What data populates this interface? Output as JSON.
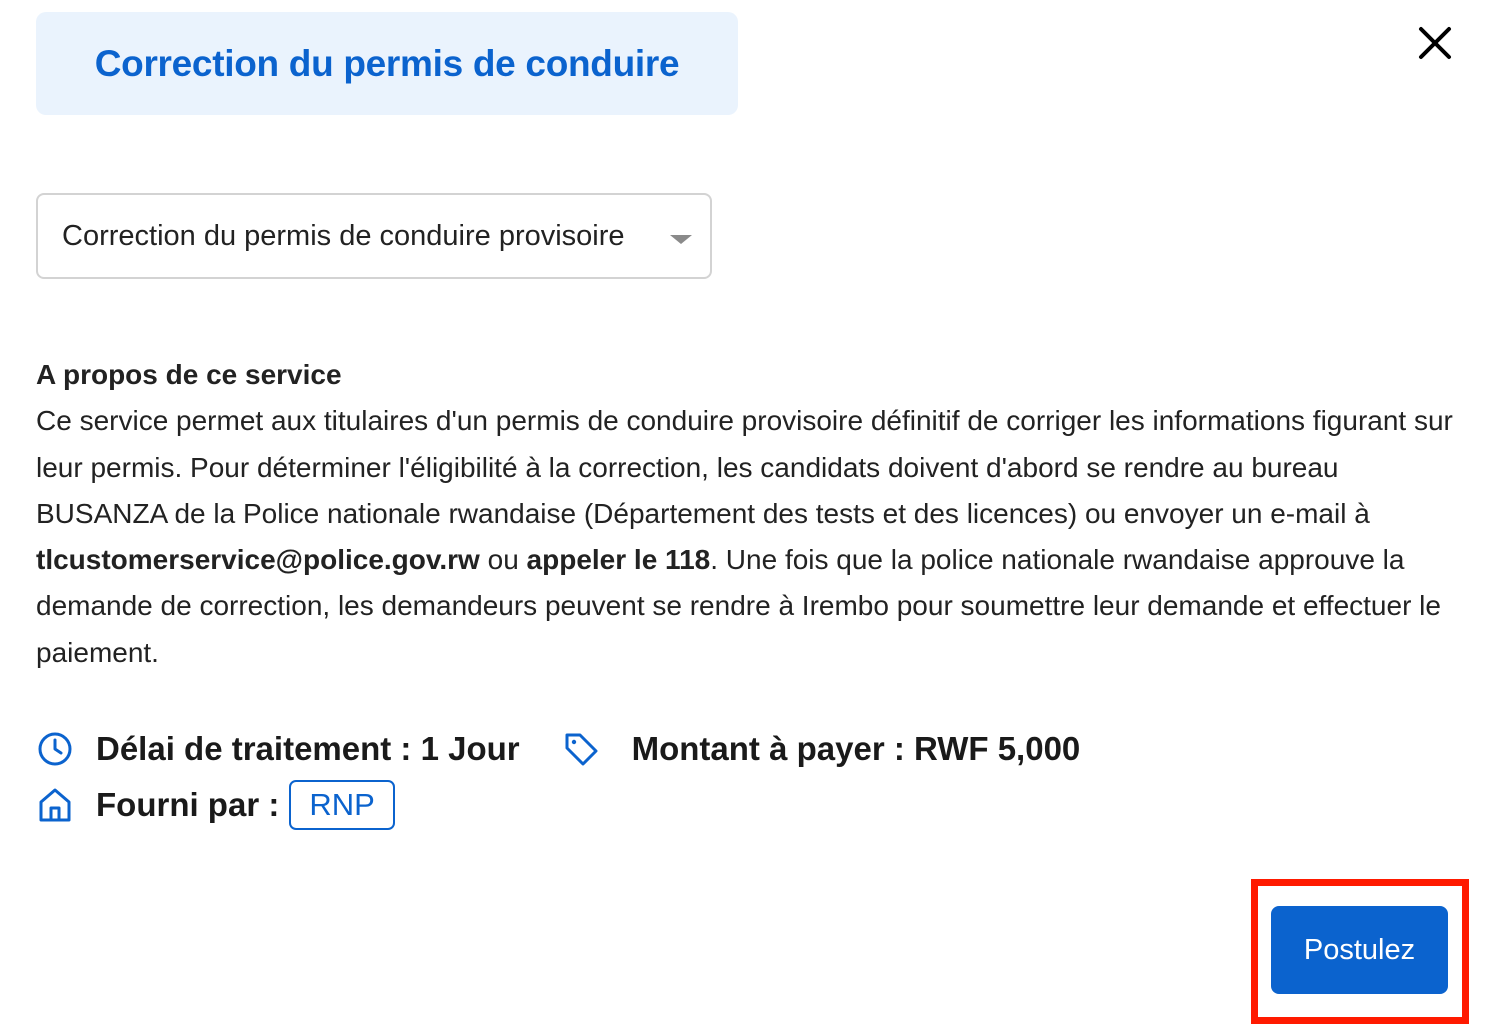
{
  "header": {
    "title": "Correction du permis de conduire"
  },
  "dialog": {
    "close_icon": "close-icon"
  },
  "service_select": {
    "selected": "Correction du permis de conduire provisoire",
    "icon": "caret-down-icon"
  },
  "about": {
    "heading": "A propos de ce service",
    "text_1": "Ce service permet aux titulaires d'un permis de conduire provisoire définitif de corriger les informations figurant sur leur permis. Pour déterminer l'éligibilité à la correction, les candidats doivent d'abord se rendre au bureau BUSANZA de la Police nationale rwandaise (Département des tests et des licences) ou envoyer un e-mail à ",
    "email": "tlcustomerservice@police.gov.rw",
    "text_2": " ou ",
    "phone": "appeler le 118",
    "text_3": ". Une fois que la police nationale rwandaise approuve la demande de correction, les demandeurs peuvent se rendre à Irembo pour soumettre leur demande et effectuer le paiement."
  },
  "meta": {
    "processing_label": "Délai de traitement : 1 Jour",
    "processing_icon": "clock-icon",
    "price_label": "Montant à payer : RWF 5,000",
    "price_icon": "tag-icon",
    "provider_label": "Fourni par :",
    "provider_icon": "home-icon",
    "provider_value": "RNP"
  },
  "actions": {
    "apply_label": "Postulez"
  },
  "colors": {
    "primary": "#0b63ce",
    "title_bg": "#eaf3fd",
    "highlight": "#ff1a00"
  }
}
